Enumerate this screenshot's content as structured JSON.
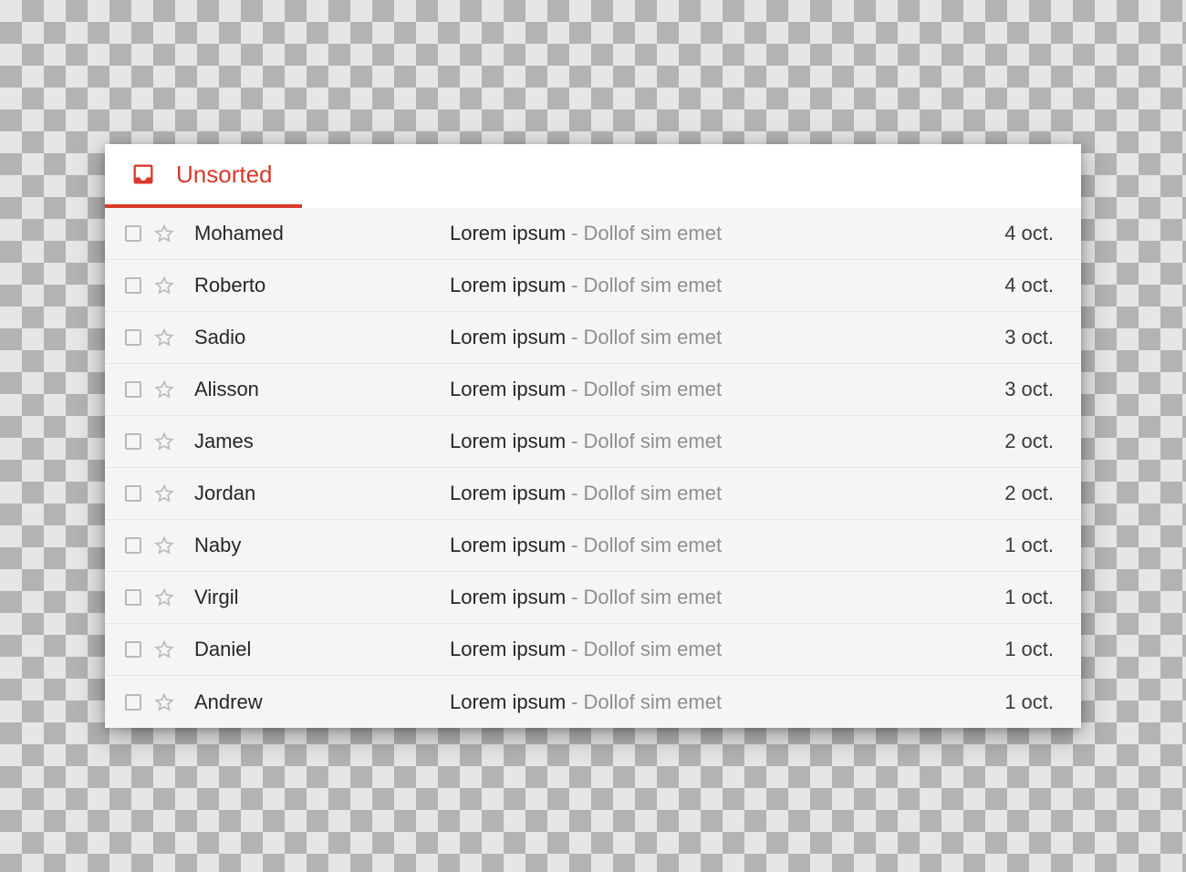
{
  "accent": "#d93a2b",
  "tab": {
    "label": "Unsorted"
  },
  "messages": [
    {
      "sender": "Mohamed",
      "subject": "Lorem ipsum",
      "preview": "Dollof sim emet",
      "date": "4 oct."
    },
    {
      "sender": "Roberto",
      "subject": "Lorem ipsum",
      "preview": "Dollof sim emet",
      "date": "4 oct."
    },
    {
      "sender": "Sadio",
      "subject": "Lorem ipsum",
      "preview": "Dollof sim emet",
      "date": "3 oct."
    },
    {
      "sender": "Alisson",
      "subject": "Lorem ipsum",
      "preview": "Dollof sim emet",
      "date": "3 oct."
    },
    {
      "sender": "James",
      "subject": "Lorem ipsum",
      "preview": "Dollof sim emet",
      "date": "2 oct."
    },
    {
      "sender": "Jordan",
      "subject": "Lorem ipsum",
      "preview": "Dollof sim emet",
      "date": "2 oct."
    },
    {
      "sender": "Naby",
      "subject": "Lorem ipsum",
      "preview": "Dollof sim emet",
      "date": "1 oct."
    },
    {
      "sender": "Virgil",
      "subject": "Lorem ipsum",
      "preview": "Dollof sim emet",
      "date": "1 oct."
    },
    {
      "sender": "Daniel",
      "subject": "Lorem ipsum",
      "preview": "Dollof sim emet",
      "date": "1 oct."
    },
    {
      "sender": "Andrew",
      "subject": "Lorem ipsum",
      "preview": "Dollof sim emet",
      "date": "1 oct."
    }
  ]
}
